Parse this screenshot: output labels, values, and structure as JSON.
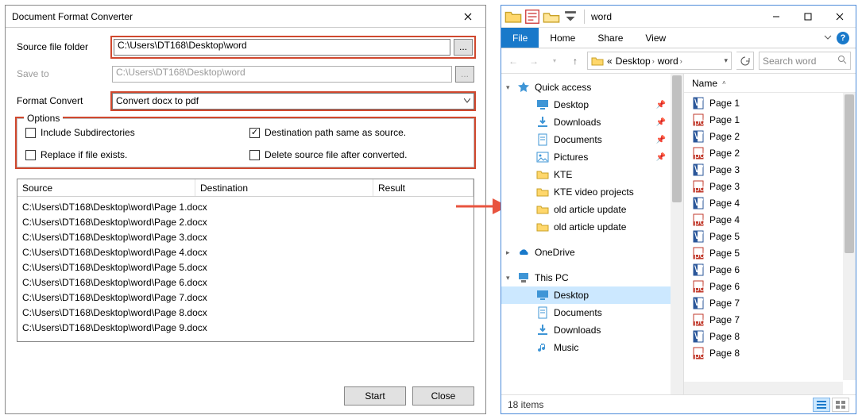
{
  "dialog": {
    "title": "Document Format Converter",
    "labels": {
      "source_folder": "Source file folder",
      "save_to": "Save to",
      "format_convert": "Format Convert",
      "options": "Options"
    },
    "fields": {
      "source_folder_value": "C:\\Users\\DT168\\Desktop\\word",
      "save_to_value": "C:\\Users\\DT168\\Desktop\\word",
      "format_convert_value": "Convert docx to pdf",
      "browse_label": "..."
    },
    "options": {
      "include_subdirs": {
        "label": "Include Subdirectories",
        "checked": false
      },
      "dest_same_as_source": {
        "label": "Destination path same as source.",
        "checked": true
      },
      "replace_if_exists": {
        "label": "Replace if file exists.",
        "checked": false
      },
      "delete_after_convert": {
        "label": "Delete source file after converted.",
        "checked": false
      }
    },
    "columns": {
      "source": "Source",
      "destination": "Destination",
      "result": "Result"
    },
    "files": [
      "C:\\Users\\DT168\\Desktop\\word\\Page 1.docx",
      "C:\\Users\\DT168\\Desktop\\word\\Page 2.docx",
      "C:\\Users\\DT168\\Desktop\\word\\Page 3.docx",
      "C:\\Users\\DT168\\Desktop\\word\\Page 4.docx",
      "C:\\Users\\DT168\\Desktop\\word\\Page 5.docx",
      "C:\\Users\\DT168\\Desktop\\word\\Page 6.docx",
      "C:\\Users\\DT168\\Desktop\\word\\Page 7.docx",
      "C:\\Users\\DT168\\Desktop\\word\\Page 8.docx",
      "C:\\Users\\DT168\\Desktop\\word\\Page 9.docx"
    ],
    "buttons": {
      "start": "Start",
      "close": "Close"
    }
  },
  "explorer": {
    "title": "word",
    "tabs": {
      "file": "File",
      "home": "Home",
      "share": "Share",
      "view": "View"
    },
    "breadcrumb": {
      "prefix": "«",
      "level1": "Desktop",
      "level2": "word"
    },
    "search_placeholder": "Search word",
    "nav": {
      "quick_access": "Quick access",
      "items_qa": [
        "Desktop",
        "Downloads",
        "Documents",
        "Pictures",
        "KTE",
        "KTE video projects",
        "old article update",
        "old article update"
      ],
      "onedrive": "OneDrive",
      "this_pc": "This PC",
      "items_pc": [
        "Desktop",
        "Documents",
        "Downloads",
        "Music"
      ]
    },
    "col_name": "Name",
    "files": [
      {
        "name": "Page 1",
        "type": "docx"
      },
      {
        "name": "Page 1",
        "type": "pdf"
      },
      {
        "name": "Page 2",
        "type": "docx"
      },
      {
        "name": "Page 2",
        "type": "pdf"
      },
      {
        "name": "Page 3",
        "type": "docx"
      },
      {
        "name": "Page 3",
        "type": "pdf"
      },
      {
        "name": "Page 4",
        "type": "docx"
      },
      {
        "name": "Page 4",
        "type": "pdf"
      },
      {
        "name": "Page 5",
        "type": "docx"
      },
      {
        "name": "Page 5",
        "type": "pdf"
      },
      {
        "name": "Page 6",
        "type": "docx"
      },
      {
        "name": "Page 6",
        "type": "pdf"
      },
      {
        "name": "Page 7",
        "type": "docx"
      },
      {
        "name": "Page 7",
        "type": "pdf"
      },
      {
        "name": "Page 8",
        "type": "docx"
      },
      {
        "name": "Page 8",
        "type": "pdf"
      }
    ],
    "status": "18 items"
  }
}
